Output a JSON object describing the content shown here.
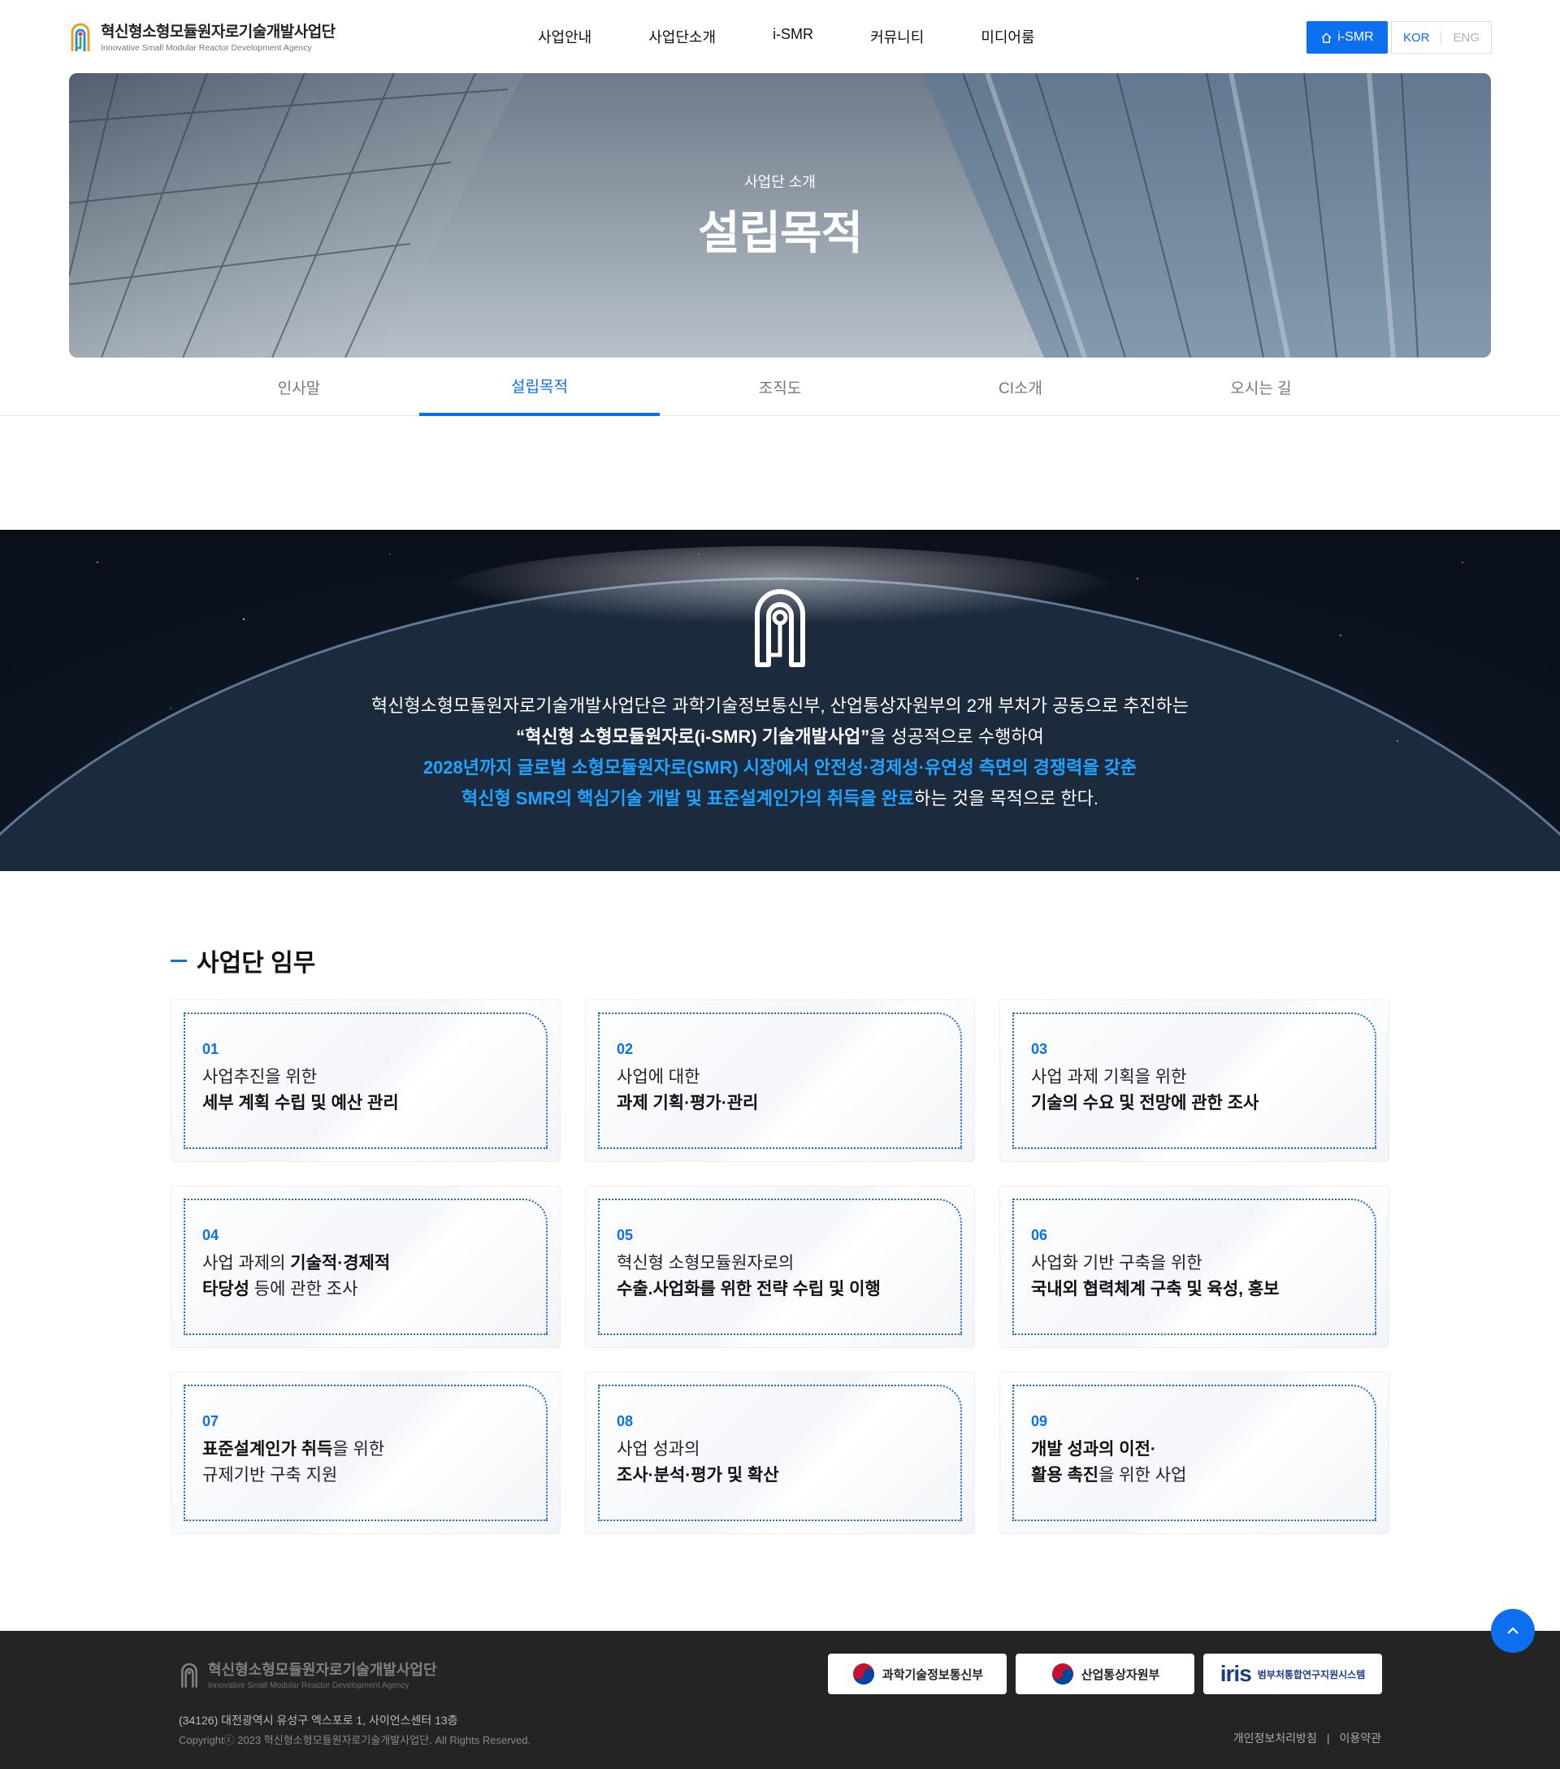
{
  "header": {
    "logo_kr": "혁신형소형모듈원자로기술개발사업단",
    "logo_en": "Innovative Small Modular Reactor Development Agency",
    "nav": [
      "사업안내",
      "사업단소개",
      "i-SMR",
      "커뮤니티",
      "미디어룸"
    ],
    "ismr_button": "i-SMR",
    "lang_kor": "KOR",
    "lang_eng": "ENG"
  },
  "hero": {
    "subtitle": "사업단 소개",
    "title": "설립목적"
  },
  "tabs": [
    {
      "label": "인사말",
      "active": false
    },
    {
      "label": "설립목적",
      "active": true
    },
    {
      "label": "조직도",
      "active": false
    },
    {
      "label": "CI소개",
      "active": false
    },
    {
      "label": "오시는 길",
      "active": false
    }
  ],
  "mission": {
    "line1": "혁신형소형모듈원자로기술개발사업단은 과학기술정보통신부, 산업통상자원부의 2개 부처가 공동으로 추진하는",
    "line2_bold": "“혁신형 소형모듈원자로(i-SMR) 기술개발사업”",
    "line2_rest": "을 성공적으로 수행하여",
    "line3_hl": "2028년까지 글로벌 소형모듈원자로(SMR) 시장에서 안전성·경제성·유연성 측면의 경쟁력을 갖춘",
    "line4_hl": "혁신형 SMR의 핵심기술 개발 및 표준설계인가의 취득을 완료",
    "line4_rest": "하는 것을 목적으로 한다."
  },
  "duties": {
    "title": "사업단 임무",
    "cards": [
      {
        "num": "01",
        "l1": "사업추진을 위한",
        "l2b": "세부 계획 수립 및 예산 관리"
      },
      {
        "num": "02",
        "l1": "사업에 대한",
        "l2b": "과제 기획·평가·관리"
      },
      {
        "num": "03",
        "l1": "사업 과제 기획을 위한",
        "l2b": "기술의 수요 및 전망에 관한 조사"
      },
      {
        "num": "04",
        "l1a": "사업 과제의 ",
        "l1b": "기술적·경제적",
        "l2b": "타당성",
        "l2c": " 등에 관한 조사"
      },
      {
        "num": "05",
        "l1": "혁신형 소형모듈원자로의",
        "l2b": "수출.사업화를 위한 전략 수립 및 이행"
      },
      {
        "num": "06",
        "l1": "사업화 기반 구축을 위한",
        "l2b": "국내외 협력체계 구축 및 육성, 홍보"
      },
      {
        "num": "07",
        "l1b": "표준설계인가 취득",
        "l1c": "을 위한",
        "l2": "규제기반 구축 지원"
      },
      {
        "num": "08",
        "l1": "사업 성과의",
        "l2b": "조사·분석·평가 및 확산"
      },
      {
        "num": "09",
        "l1b": "개발 성과의 이전·",
        "l2b": "활용 촉진",
        "l2c": "을 위한 사업"
      }
    ]
  },
  "footer": {
    "logo_kr": "혁신형소형모듈원자로기술개발사업단",
    "logo_en": "Innovative Small Modular Reactor Development Agency",
    "address": "(34126) 대전광역시 유성구 엑스포로 1, 사이언스센터 13층",
    "copyright": "Copyrightⓒ 2023 혁신형소형모듈원자로기술개발사업단. All Rights Reserved.",
    "partners": [
      "과학기술정보통신부",
      "산업통상자원부",
      "범부처통합연구지원시스템"
    ],
    "iris": "iris",
    "links": [
      "개인정보처리방침",
      "이용약관"
    ],
    "link_sep": "|"
  },
  "colors": {
    "accent": "#0b6ff0",
    "highlight": "#1ea4ff",
    "footer_bg": "#242424"
  }
}
